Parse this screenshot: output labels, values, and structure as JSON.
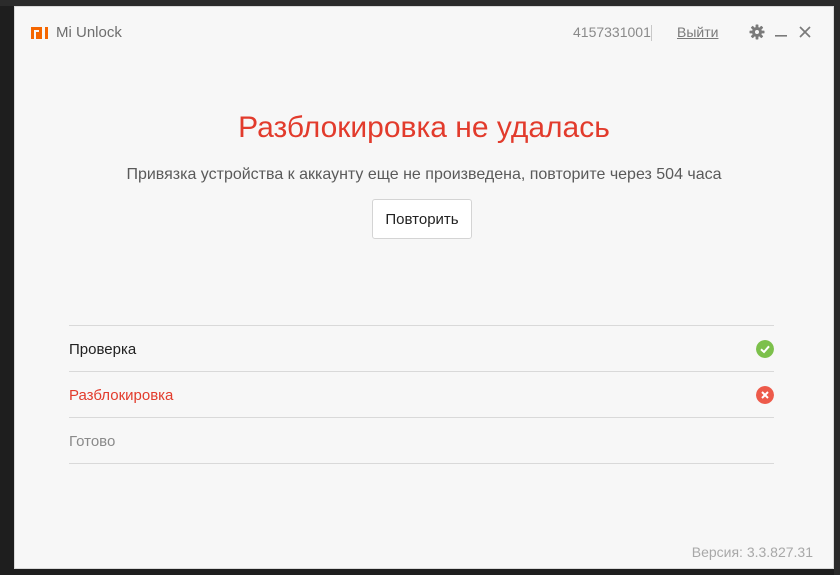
{
  "app": {
    "title": "Mi Unlock"
  },
  "header": {
    "account_id": "4157331001",
    "logout_label": "Выйти",
    "icons": [
      "gear-icon",
      "minimize-icon",
      "close-icon"
    ]
  },
  "status": {
    "title": "Разблокировка не удалась",
    "message": "Привязка устройства к аккаунту еще не произведена, повторите через 504 часа",
    "retry_label": "Повторить"
  },
  "steps": [
    {
      "label": "Проверка",
      "state": "success",
      "color": "#222222"
    },
    {
      "label": "Разблокировка",
      "state": "failed",
      "color": "#e23b2c"
    },
    {
      "label": "Готово",
      "state": "pending",
      "color": "#8a8a8a"
    }
  ],
  "footer": {
    "version": "Версия: 3.3.827.31"
  },
  "colors": {
    "accent_red": "#e23b2c",
    "success_green": "#7cc04b",
    "error_red": "#ed5a4a",
    "logo_orange": "#f56600"
  }
}
